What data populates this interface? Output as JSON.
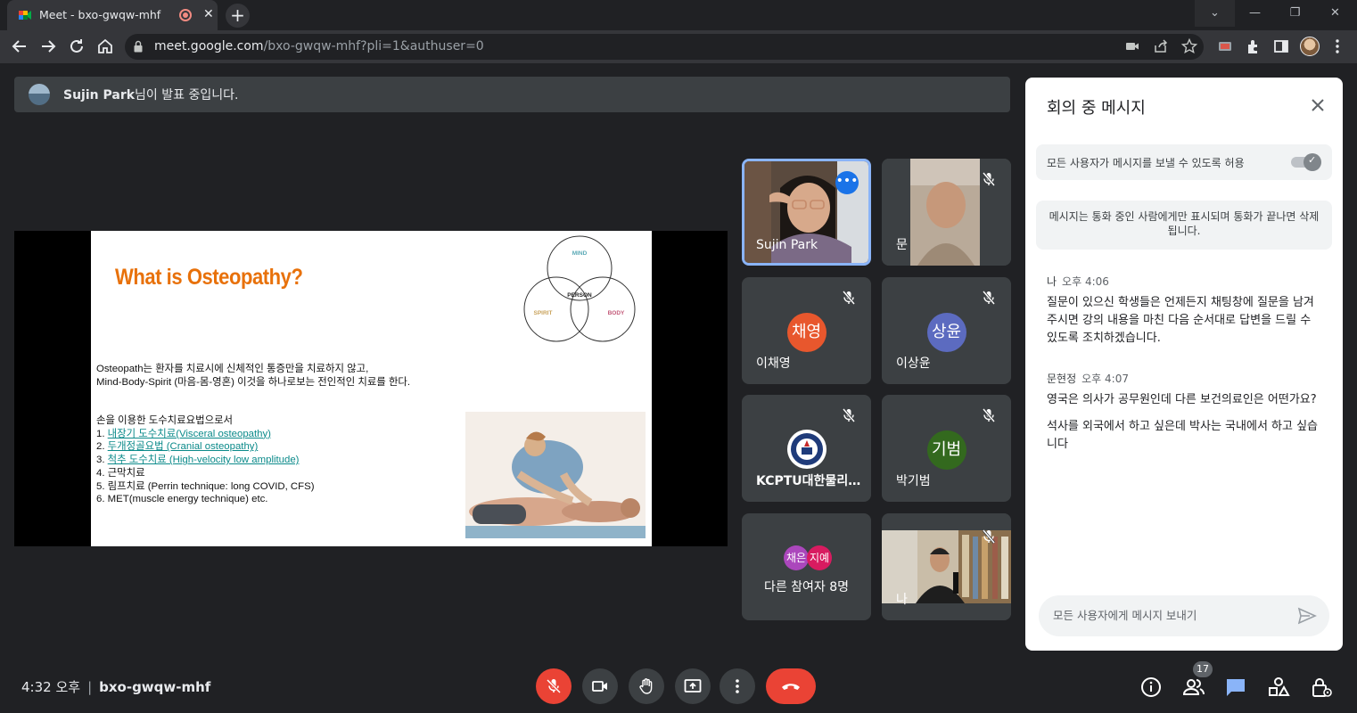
{
  "browser": {
    "tab_title": "Meet - bxo-gwqw-mhf",
    "tab_close": "✕",
    "new_tab": "+",
    "window_controls": [
      "⌄",
      "—",
      "❐",
      "✕"
    ],
    "url_host": "meet.google.com",
    "url_path": "/bxo-gwqw-mhf?pli=1&authuser=0"
  },
  "presenting": {
    "name": "Sujin Park",
    "suffix": "님이 발표 중입니다."
  },
  "slide": {
    "title": "What is Osteopathy?",
    "venn": {
      "top": "MIND",
      "center": "PERSON",
      "left": "SPIRIT",
      "right": "BODY"
    },
    "intro_lines": [
      "Osteopath는 환자를 치료시에 신체적인 통증만을 치료하지 않고,",
      "Mind-Body-Spirit (마음-몸-영혼) 이것을 하나로보는 전인적인 치료를 한다."
    ],
    "list_heading": "손을 이용한 도수치료요법으로서",
    "list": [
      {
        "num": "1. ",
        "text": "내장기 도수치료(Visceral osteopathy)"
      },
      {
        "num": "2. ",
        "text": "두개정골요법 (Cranial osteopathy)"
      },
      {
        "num": "3. ",
        "text": "척추 도수치료 (High-velocity low amplitude)"
      },
      {
        "num": "4. ",
        "text": "근막치료"
      },
      {
        "num": "5. ",
        "text": "림프치료 (Perrin technique: long COVID, CFS)"
      },
      {
        "num": "6. ",
        "text": "MET(muscle energy technique) etc."
      }
    ]
  },
  "tiles": [
    {
      "name": "Sujin Park",
      "more": "•••"
    },
    {
      "name": "문"
    },
    {
      "name": "이채영",
      "initial": "채영",
      "color": "#e8572d"
    },
    {
      "name": "이상윤",
      "initial": "상윤",
      "color": "#5c6bc0"
    },
    {
      "name": "KCPTU대한물리치료사노동조합"
    },
    {
      "name": "박기범",
      "initial": "기범",
      "color": "#33691e"
    },
    {
      "others_label": "다른 참여자 8명",
      "mini": [
        "채은",
        "지예"
      ],
      "mini_colors": [
        "#ab47bc",
        "#d81b60"
      ]
    },
    {
      "name": "나"
    }
  ],
  "chat": {
    "title": "회의 중 메시지",
    "allow_label": "모든 사용자가 메시지를 보낼 수 있도록 허용",
    "allow_enabled": true,
    "info": "메시지는 통화 중인 사람에게만 표시되며 통화가 끝나면 삭제됩니다.",
    "messages": [
      {
        "sender": "나",
        "time": "오후 4:06",
        "texts": [
          "질문이 있으신 학생들은 언제든지 채팅창에 질문을 남겨주시면 강의 내용을 마친 다음 순서대로 답변을 드릴 수 있도록 조치하겠습니다."
        ]
      },
      {
        "sender": "문현정",
        "time": "오후 4:07",
        "texts": [
          "영국은 의사가 공무원인데 다른 보건의료인은 어떤가요?",
          "석사를 외국에서 하고 싶은데 박사는 국내에서 하고 싶습니다"
        ]
      }
    ],
    "input_placeholder": "모든 사용자에게 메시지 보내기"
  },
  "bottom": {
    "time": "4:32 오후",
    "separator": "|",
    "meeting_code": "bxo-gwqw-mhf",
    "participants_count": "17"
  },
  "colors": {
    "accent_blue": "#8ab4f8",
    "danger_red": "#ea4335",
    "slide_title": "#e8710a",
    "link_teal": "#0b8a8a"
  }
}
